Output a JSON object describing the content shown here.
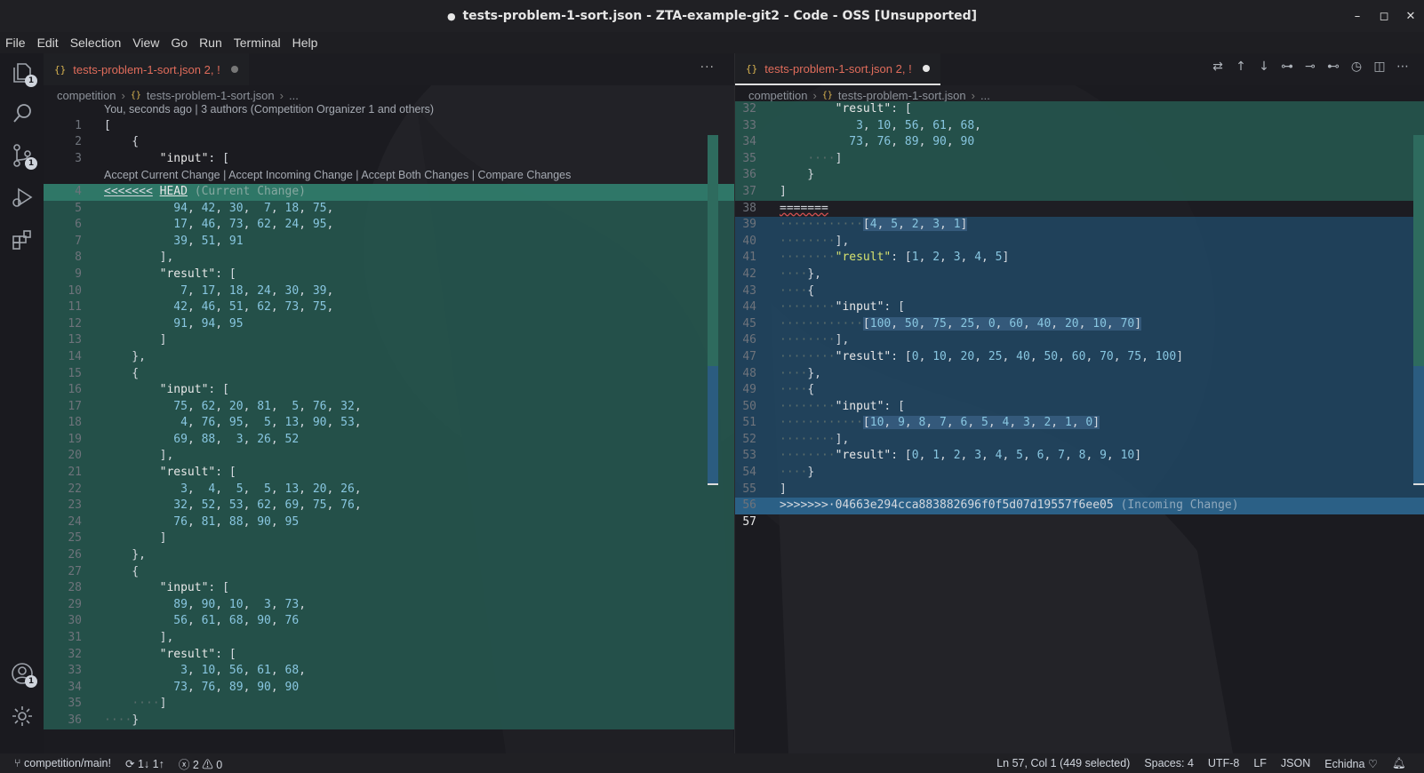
{
  "window": {
    "title": "tests-problem-1-sort.json - ZTA-example-git2 - Code - OSS [Unsupported]",
    "dirty_marker": "●",
    "controls": [
      "–",
      "◻",
      "✕"
    ]
  },
  "menu": [
    "File",
    "Edit",
    "Selection",
    "View",
    "Go",
    "Run",
    "Terminal",
    "Help"
  ],
  "activity": {
    "explorer_badge": "1",
    "scm_badge": "1",
    "accounts_badge": "1"
  },
  "left": {
    "tab_icon": "{}",
    "tab_label": "tests-problem-1-sort.json 2, !",
    "more": "···",
    "breadcrumb": [
      "competition",
      "tests-problem-1-sort.json",
      "..."
    ],
    "blame": "You, seconds ago | 3 authors (Competition Organizer 1 and others)",
    "codelens": [
      "Accept Current Change",
      "Accept Incoming Change",
      "Accept Both Changes",
      "Compare Changes"
    ],
    "marker_head": "<<<<<<<",
    "marker_head_ref": "HEAD",
    "marker_head_note": "(Current Change)"
  },
  "right": {
    "tab_icon": "{}",
    "tab_label": "tests-problem-1-sort.json 2, !",
    "breadcrumb": [
      "competition",
      "tests-problem-1-sort.json",
      "..."
    ],
    "marker_sep": "=======",
    "marker_incoming": ">>>>>>>·04663e294cca883882696f0f5d07d19557f6ee05",
    "marker_incoming_note": "(Incoming Change)"
  },
  "status": {
    "branch": "competition/main!",
    "sync": "1↓ 1↑",
    "errors": "2",
    "warnings": "0",
    "position": "Ln 57, Col 1 (449 selected)",
    "spaces": "Spaces: 4",
    "encoding": "UTF-8",
    "eol": "LF",
    "language": "JSON",
    "theme": "Echidna ♡"
  },
  "colors": {
    "current_change": "#265f54",
    "incoming_change": "#214a68",
    "tab_label": "#e06c5b",
    "keyword": "#d7e26f",
    "number": "#88c6e0"
  }
}
